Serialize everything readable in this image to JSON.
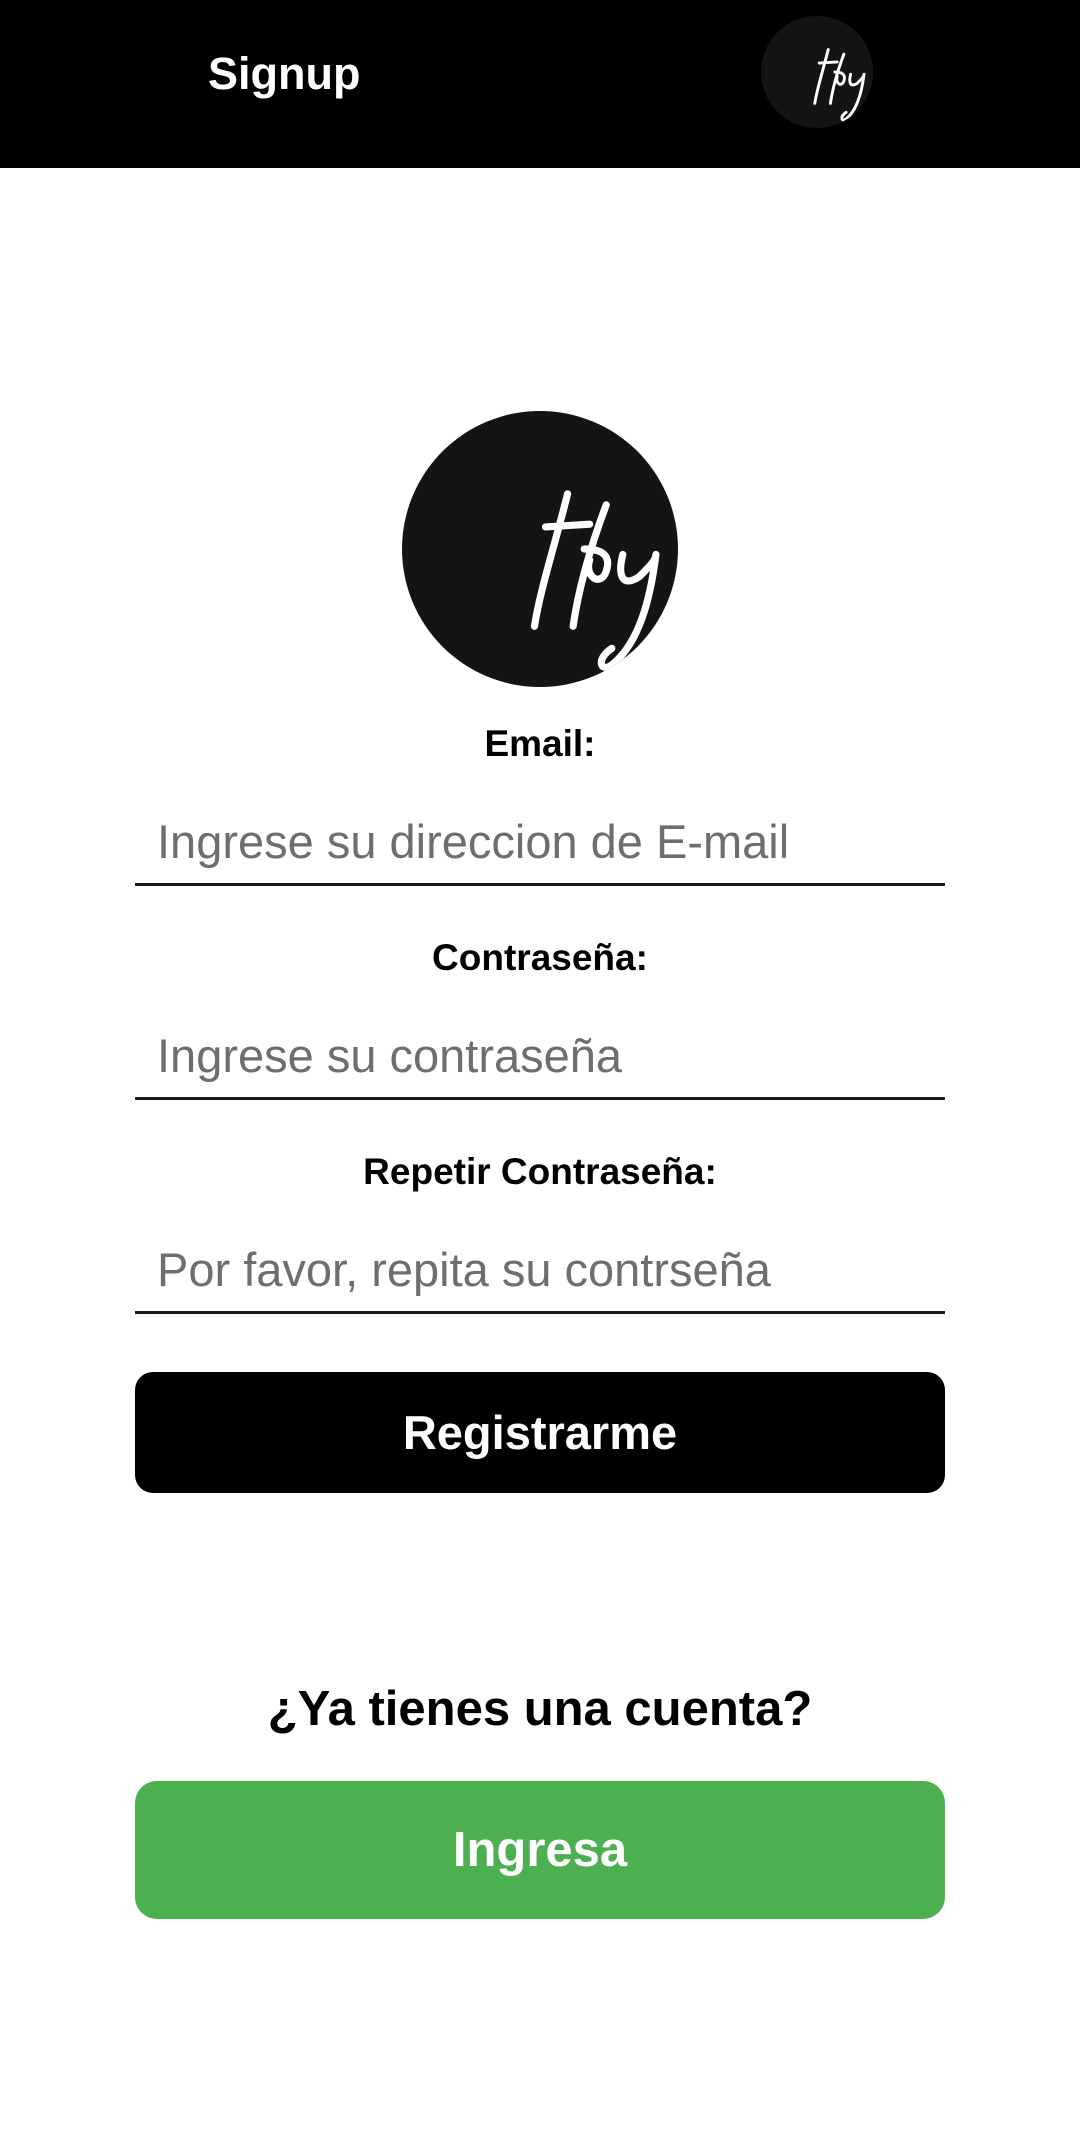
{
  "app_bar": {
    "title": "Signup",
    "logo_icon": "tfy-logo-icon"
  },
  "logo": {
    "icon": "tfy-logo-icon",
    "background": "#141414"
  },
  "form": {
    "email": {
      "label": "Email:",
      "value": "",
      "placeholder": "Ingrese su direccion de E-mail"
    },
    "password": {
      "label": "Contraseña:",
      "value": "",
      "placeholder": "Ingrese su contraseña"
    },
    "repeat_password": {
      "label": "Repetir Contraseña:",
      "value": "",
      "placeholder": "Por favor, repita su contrseña"
    },
    "register_label": "Registrarme"
  },
  "login_prompt": {
    "text": "¿Ya tienes una cuenta?",
    "button_label": "Ingresa"
  },
  "colors": {
    "app_bar": "#000000",
    "primary_button": "#000000",
    "login_button": "#4caf50",
    "background": "#ffffff"
  }
}
